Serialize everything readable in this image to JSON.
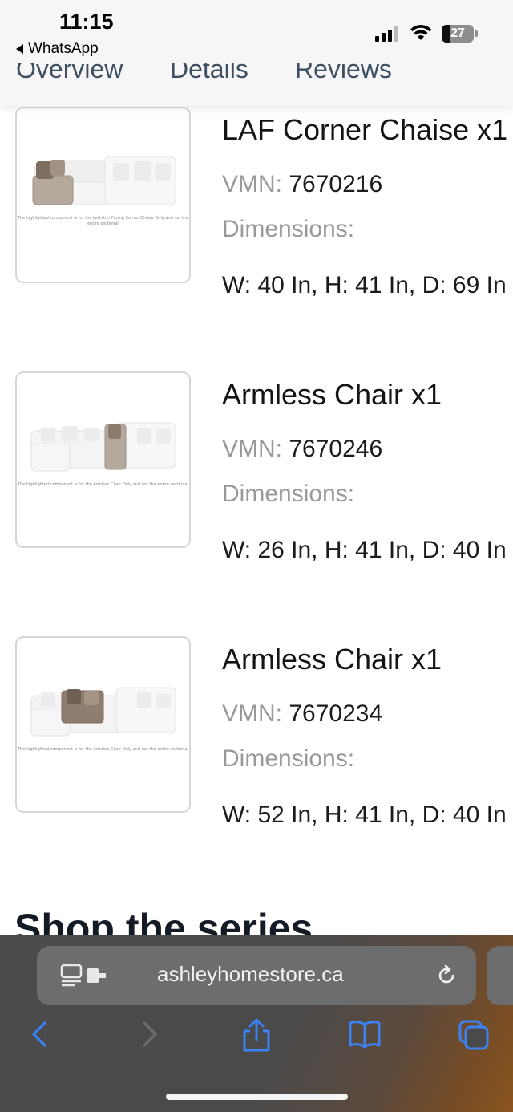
{
  "status_bar": {
    "time": "11:15",
    "back_app": "WhatsApp",
    "battery_level": "27"
  },
  "tabs": [
    {
      "label": "Overview"
    },
    {
      "label": "Details"
    },
    {
      "label": "Reviews"
    }
  ],
  "items": [
    {
      "name": "LAF Corner Chaise x1",
      "vmn_label": "VMN:",
      "vmn": "7670216",
      "dimensions_label": "Dimensions:",
      "dimensions": "W: 40 In, H: 41 In, D: 69 In",
      "image_caption": "The highlighted component is for the Left-Arm Facing Corner Chaise Only and not the entire sectional"
    },
    {
      "name": "Armless Chair x1",
      "vmn_label": "VMN:",
      "vmn": "7670246",
      "dimensions_label": "Dimensions:",
      "dimensions": "W: 26 In, H: 41 In, D: 40 In",
      "image_caption": "The highlighted component is for the Armless Chair Only and not the entire sectional"
    },
    {
      "name": "Armless Chair x1",
      "vmn_label": "VMN:",
      "vmn": "7670234",
      "dimensions_label": "Dimensions:",
      "dimensions": "W: 52 In, H: 41 In, D: 40 In",
      "image_caption": "The highlighted component is for the Armless Chair Only and not the entire sectional"
    }
  ],
  "series_heading": "Shop the series",
  "browser": {
    "url": "ashleyhomestore.ca",
    "icons": [
      "page-menu-icon",
      "reload-icon",
      "back-icon",
      "forward-icon",
      "share-icon",
      "bookmarks-icon",
      "tabs-icon"
    ],
    "accent": "#3b82f6"
  }
}
